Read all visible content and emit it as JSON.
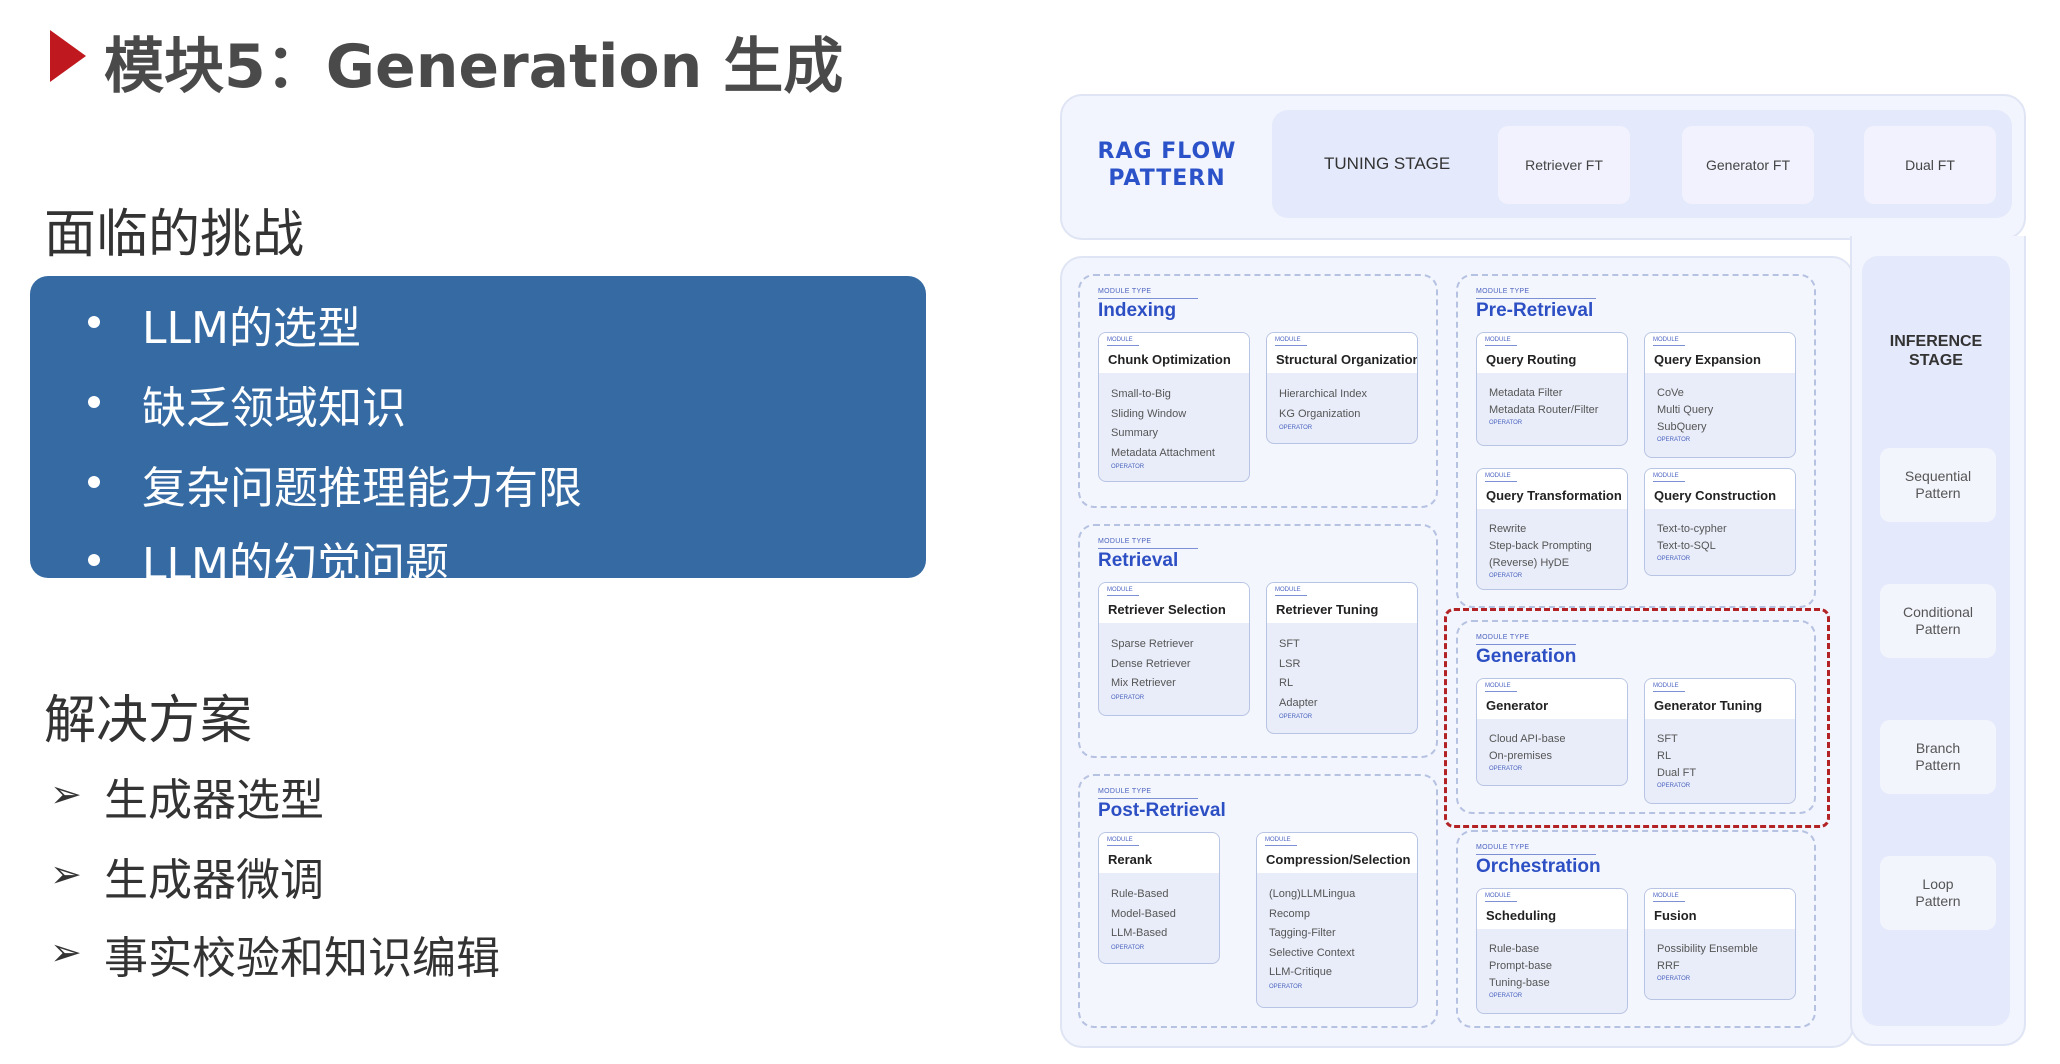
{
  "slide": {
    "title": "模块5：Generation 生成",
    "challenges_heading": "面临的挑战",
    "challenges": [
      "LLM的选型",
      "缺乏领域知识",
      "复杂问题推理能力有限",
      "LLM的幻觉问题"
    ],
    "solutions_heading": "解决方案",
    "solutions": [
      "生成器选型",
      "生成器微调",
      "事实校验和知识编辑"
    ],
    "colors": {
      "accent_red": "#c0181f",
      "box_blue": "#356aa3",
      "diagram_blue": "#2b52c9"
    }
  },
  "diagram": {
    "rag_flow": "RAG FLOW\nPATTERN",
    "tuning_stage": "TUNING STAGE",
    "tuning_items": [
      "Retriever FT",
      "Generator FT",
      "Dual FT"
    ],
    "inference_stage": "INFERENCE\nSTAGE",
    "patterns": [
      "Sequential\nPattern",
      "Conditional\nPattern",
      "Branch\nPattern",
      "Loop\nPattern"
    ],
    "module_type_caption": "MODULE TYPE",
    "module_caption": "MODULE",
    "operator_caption": "OPERATOR",
    "module_types": {
      "indexing": {
        "name": "Indexing",
        "modules": [
          {
            "name": "Chunk Optimization",
            "items": "Small-to-Big\nSliding Window\nSummary\nMetadata Attachment"
          },
          {
            "name": "Structural Organization",
            "items": "Hierarchical Index\nKG Organization"
          }
        ]
      },
      "retrieval": {
        "name": "Retrieval",
        "modules": [
          {
            "name": "Retriever Selection",
            "items": "Sparse Retriever\nDense Retriever\nMix Retriever"
          },
          {
            "name": "Retriever Tuning",
            "items": "SFT\nLSR\nRL\nAdapter"
          }
        ]
      },
      "post_retrieval": {
        "name": "Post-Retrieval",
        "modules": [
          {
            "name": "Rerank",
            "items": "Rule-Based\nModel-Based\nLLM-Based"
          },
          {
            "name": "Compression/Selection",
            "items": "(Long)LLMLingua\nRecomp\nTagging-Filter\nSelective Context\nLLM-Critique"
          }
        ]
      },
      "pre_retrieval": {
        "name": "Pre-Retrieval",
        "modules": [
          {
            "name": "Query Routing",
            "items": "Metadata Filter\nMetadata Router/Filter"
          },
          {
            "name": "Query Expansion",
            "items": "CoVe\nMulti Query\nSubQuery"
          },
          {
            "name": "Query Transformation",
            "items": "Rewrite\nStep-back Prompting\n(Reverse) HyDE"
          },
          {
            "name": "Query Construction",
            "items": "Text-to-cypher\nText-to-SQL"
          }
        ]
      },
      "generation": {
        "name": "Generation",
        "modules": [
          {
            "name": "Generator",
            "items": "Cloud API-base\nOn-premises"
          },
          {
            "name": "Generator Tuning",
            "items": "SFT\nRL\nDual FT"
          }
        ]
      },
      "orchestration": {
        "name": "Orchestration",
        "modules": [
          {
            "name": "Scheduling",
            "items": "Rule-base\nPrompt-base\nTuning-base"
          },
          {
            "name": "Fusion",
            "items": "Possibility Ensemble\nRRF"
          }
        ]
      }
    }
  }
}
